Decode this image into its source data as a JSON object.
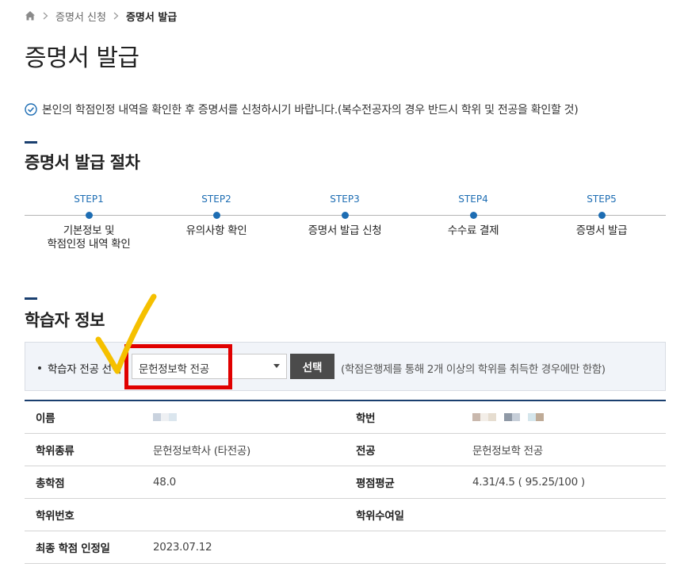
{
  "breadcrumb": {
    "items": [
      "증명서 신청",
      "증명서 발급"
    ]
  },
  "page": {
    "title": "증명서 발급",
    "notice": "본인의 학점인정 내역을 확인한 후 증명서를 신청하시기 바랍니다.(복수전공자의 경우 반드시 학위 및 전공을 확인할 것)"
  },
  "procedure": {
    "title": "증명서 발급 절차",
    "steps": [
      {
        "num": "STEP1",
        "label": "기본정보 및\n학점인정 내역 확인"
      },
      {
        "num": "STEP2",
        "label": "유의사항 확인"
      },
      {
        "num": "STEP3",
        "label": "증명서 발급 신청"
      },
      {
        "num": "STEP4",
        "label": "수수료 결제"
      },
      {
        "num": "STEP5",
        "label": "증명서 발급"
      }
    ]
  },
  "learner": {
    "title": "학습자 정보",
    "select_label": "학습자 전공 선택",
    "selected_major": "문헌정보학 전공",
    "select_button": "선택",
    "hint": "(학점은행제를 통해 2개 이상의 학위를 취득한 경우에만 한함)"
  },
  "info": {
    "name_label": "이름",
    "student_no_label": "학번",
    "degree_type_label": "학위종류",
    "degree_type_value": "문헌정보학사 (타전공)",
    "major_label": "전공",
    "major_value": "문헌정보학 전공",
    "total_credits_label": "총학점",
    "total_credits_value": "48.0",
    "gpa_label": "평점평균",
    "gpa_value": "4.31/4.5 ( 95.25/100 )",
    "degree_no_label": "학위번호",
    "degree_date_label": "학위수여일",
    "final_date_label": "최종 학점 인정일",
    "final_date_value": "2023.07.12"
  },
  "colors": {
    "accent": "#1d6db3",
    "navy": "#1a3f6f",
    "highlight": "#e00000",
    "checkmark": "#f5c000"
  }
}
